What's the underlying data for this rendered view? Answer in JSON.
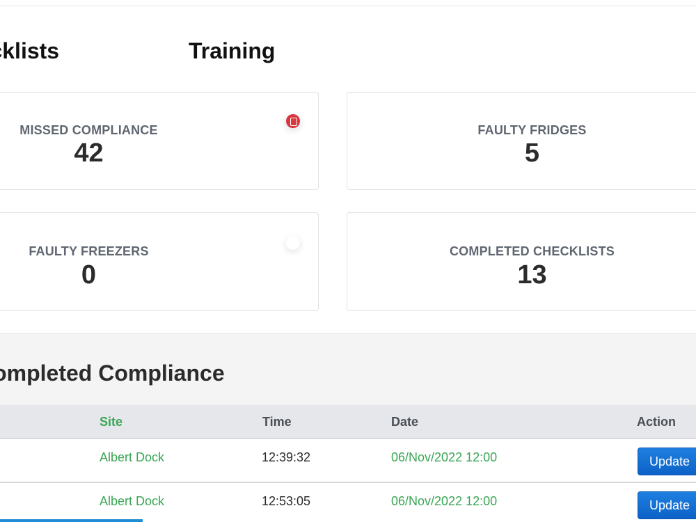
{
  "tabs": {
    "checklists": "Checklists",
    "training": "Training"
  },
  "cards": [
    {
      "label": "MISSED COMPLIANCE",
      "value": "42"
    },
    {
      "label": "FAULTY FRIDGES",
      "value": "5"
    },
    {
      "label": "FAULTY FREEZERS",
      "value": "0"
    },
    {
      "label": "COMPLETED CHECKLISTS",
      "value": "13"
    }
  ],
  "section": {
    "title": "Completed Compliance",
    "columns": {
      "site": "Site",
      "time": "Time",
      "date": "Date",
      "action": "Action"
    },
    "rows": [
      {
        "site": "Albert Dock",
        "time": "12:39:32",
        "date": "06/Nov/2022 12:00",
        "action": "Update"
      },
      {
        "site": "Albert Dock",
        "time": "12:53:05",
        "date": "06/Nov/2022 12:00",
        "action": "Update"
      }
    ]
  },
  "icons": {
    "missed_badge": "tablet-icon",
    "freezers_badge": "dot-icon"
  },
  "colors": {
    "accent_green": "#3aa655",
    "alert_red": "#d9363e",
    "button_blue": "#1472d8"
  }
}
